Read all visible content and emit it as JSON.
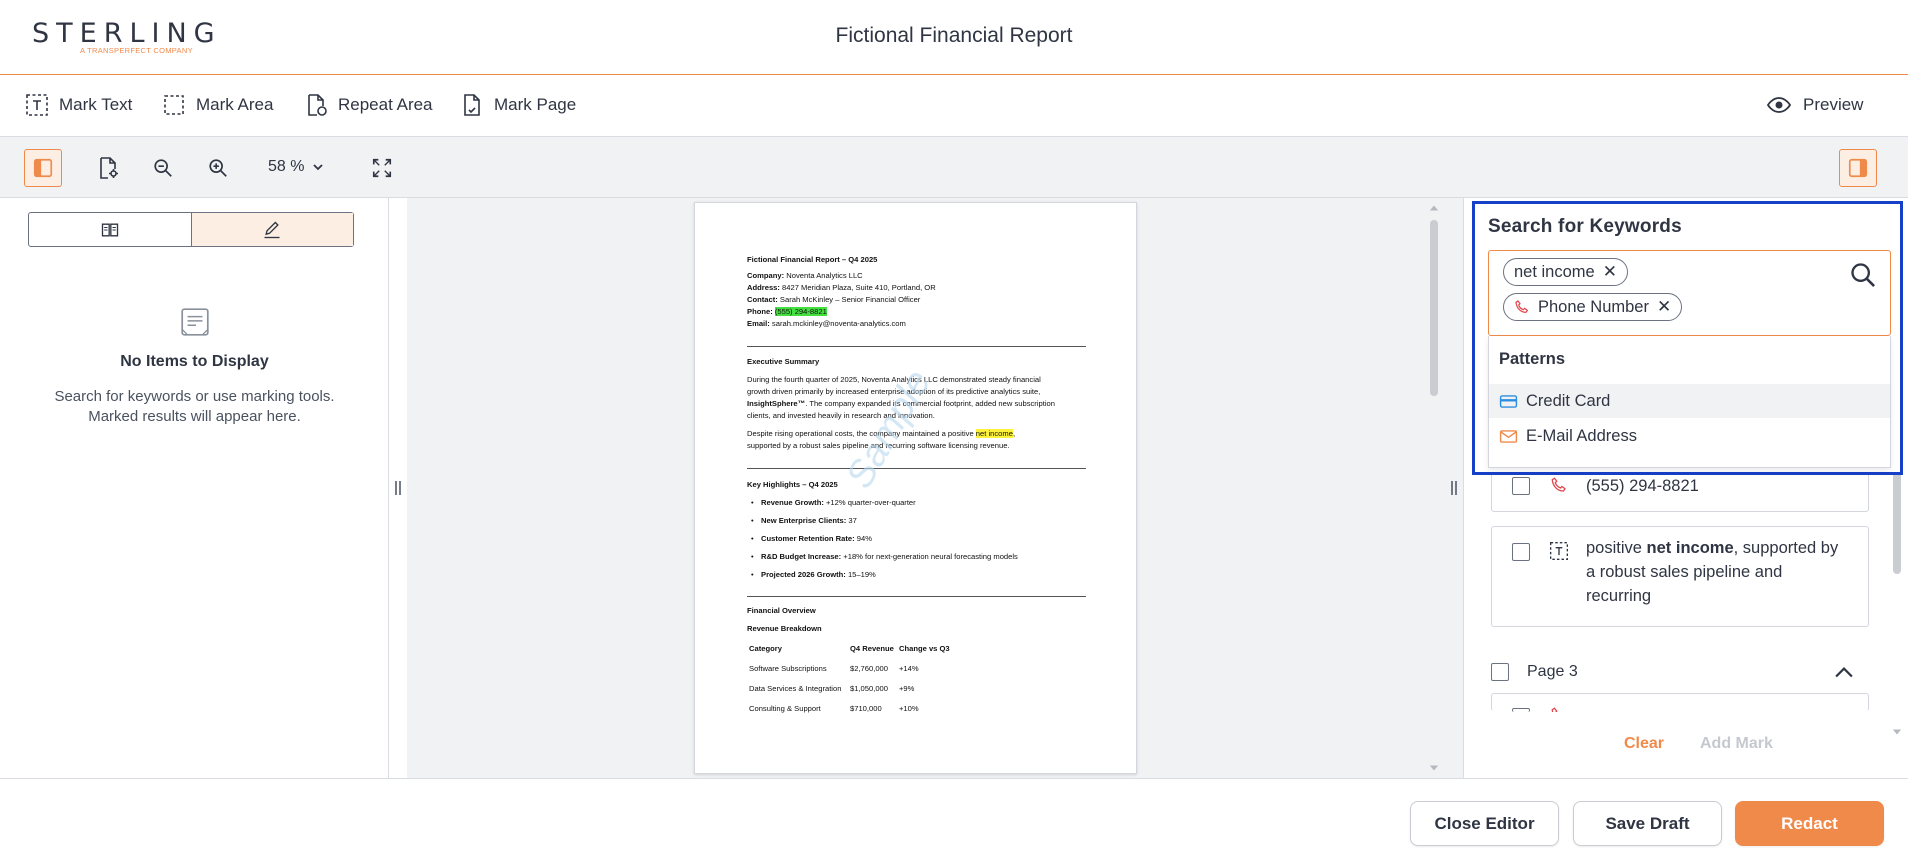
{
  "header": {
    "logo_text": "STERLING",
    "logo_subtext": "A TRANSPERFECT COMPANY",
    "title": "Fictional Financial Report"
  },
  "toolbar": {
    "mark_text": "Mark Text",
    "mark_area": "Mark Area",
    "repeat_area": "Repeat Area",
    "mark_page": "Mark Page",
    "preview": "Preview"
  },
  "viewbar": {
    "zoom_level": "58",
    "zoom_unit": "%"
  },
  "left_panel": {
    "empty_title": "No Items to Display",
    "empty_line1": "Search for keywords or use marking tools.",
    "empty_line2": "Marked results will appear here."
  },
  "document": {
    "title": "Fictional Financial Report – Q4 2025",
    "company_label": "Company:",
    "company": "Noventa Analytics LLC",
    "address_label": "Address:",
    "address": "8427 Meridian Plaza, Suite 410, Portland, OR",
    "contact_label": "Contact:",
    "contact": "Sarah McKinley – Senior Financial Officer",
    "phone_label": "Phone:",
    "phone": "(555) 294-8821",
    "email_label": "Email:",
    "email": "sarah.mckinley@noventa-analytics.com",
    "exec_heading": "Executive Summary",
    "exec_p1_l1": "During the fourth quarter of 2025, Noventa Analytics LLC demonstrated steady financial",
    "exec_p1_l2": "growth driven primarily by increased enterprise adoption of its predictive analytics suite,",
    "exec_p1_l3_bold": "InsightSphere™",
    "exec_p1_l3": ". The company expanded its commercial footprint, added new subscription",
    "exec_p1_l4": "clients, and invested heavily in research and innovation.",
    "exec_p2_l1_pre": "Despite rising operational costs, the company maintained a positive ",
    "exec_p2_l1_hl": "net income",
    "exec_p2_l1_post": ",",
    "exec_p2_l2": "supported by a robust sales pipeline and recurring software licensing revenue.",
    "highlights_heading": "Key Highlights – Q4 2025",
    "highlights": [
      {
        "label": "Revenue Growth:",
        "value": " +12% quarter-over-quarter"
      },
      {
        "label": "New Enterprise Clients:",
        "value": " 37"
      },
      {
        "label": "Customer Retention Rate:",
        "value": " 94%"
      },
      {
        "label": "R&D Budget Increase:",
        "value": " +18% for next-generation neural forecasting models"
      },
      {
        "label": "Projected 2026 Growth:",
        "value": " 15–19%"
      }
    ],
    "fin_heading": "Financial Overview",
    "rev_heading": "Revenue Breakdown",
    "table_headers": [
      "Category",
      "Q4 Revenue",
      "Change vs Q3"
    ],
    "table_rows": [
      [
        "Software Subscriptions",
        "$2,760,000",
        "+14%"
      ],
      [
        "Data Services & Integration",
        "$1,050,000",
        "+9%"
      ],
      [
        "Consulting & Support",
        "$710,000",
        "+10%"
      ]
    ],
    "watermark": "Sample"
  },
  "search": {
    "title": "Search for Keywords",
    "chips": [
      {
        "label": "net income",
        "icon": "none"
      },
      {
        "label": "Phone Number",
        "icon": "phone-icon"
      }
    ],
    "patterns_heading": "Patterns",
    "patterns": [
      {
        "label": "Credit Card",
        "icon": "credit-card-icon",
        "color": "#2d8ee0"
      },
      {
        "label": "E-Mail Address",
        "icon": "email-icon",
        "color": "#f08a4b"
      }
    ]
  },
  "results": {
    "phone_result": "(555) 294-8821",
    "text_result_pre": "positive ",
    "text_result_bold": "net income",
    "text_result_post1": ", supported by",
    "text_result_l2": "a robust sales pipeline and",
    "text_result_l3": "recurring",
    "page3_label": "Page 3",
    "clear_label": "Clear",
    "add_mark_label": "Add Mark"
  },
  "footer": {
    "close_editor": "Close Editor",
    "save_draft": "Save Draft",
    "redact": "Redact"
  },
  "colors": {
    "accent": "#f08a4b",
    "selection_border": "#1740c9",
    "highlight_phone": "#44e040",
    "highlight_keyword": "#fff23a",
    "phone_icon": "#e0454a"
  }
}
